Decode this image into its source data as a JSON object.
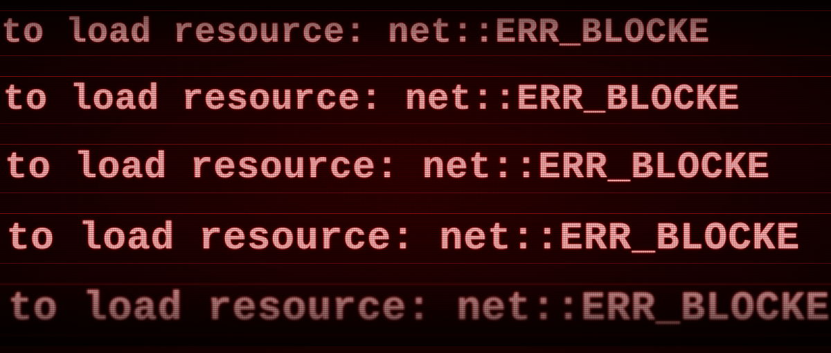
{
  "console": {
    "lines": [
      "d to load resource: net::ERR_BLOCKE",
      "d to load resource: net::ERR_BLOCKE",
      "d to load resource: net::ERR_BLOCKE",
      "d to load resource: net::ERR_BLOCKE",
      "d to load resource: net::ERR_BLOCKE"
    ]
  }
}
